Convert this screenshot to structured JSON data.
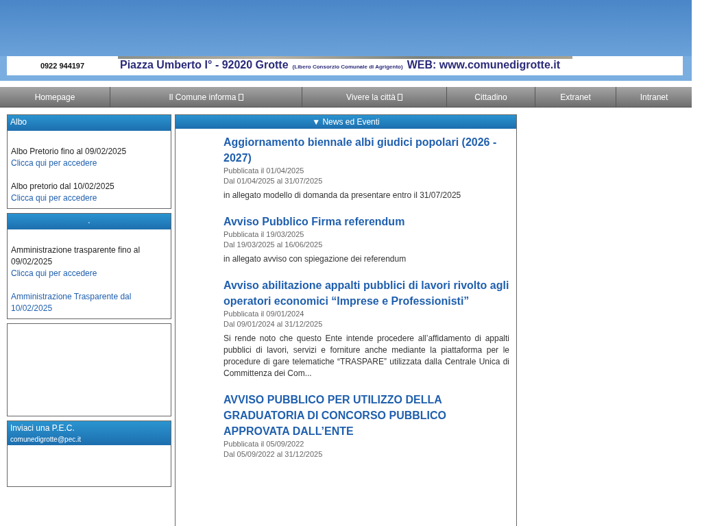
{
  "banner": {
    "phone": "0922 944197",
    "address": "Piazza Umberto I°  - 92020 Grotte",
    "region": "(Libero Consorzio Comunale di Agrigento)",
    "web": "WEB: www.comunedigrotte.it"
  },
  "nav": [
    {
      "label": "Homepage",
      "has_submenu": false
    },
    {
      "label": "Il Comune informa",
      "has_submenu": true
    },
    {
      "label": "Vivere la città",
      "has_submenu": true
    },
    {
      "label": "Cittadino",
      "has_submenu": false
    },
    {
      "label": "Extranet",
      "has_submenu": false
    },
    {
      "label": "Intranet",
      "has_submenu": false
    }
  ],
  "sidebar": [
    {
      "kind": "links",
      "title": "Albo",
      "items": [
        {
          "kind": "text",
          "text": "Albo Pretorio fino al 09/02/2025"
        },
        {
          "kind": "link",
          "text": "Clicca qui per accedere"
        },
        {
          "kind": "gap"
        },
        {
          "kind": "text",
          "text": "Albo pretorio dal 10/02/2025"
        },
        {
          "kind": "link",
          "text": "Clicca qui per accedere"
        }
      ]
    },
    {
      "kind": "links",
      "title": ".",
      "items": [
        {
          "kind": "text",
          "text": "Amministrazione trasparente fino al 09/02/2025"
        },
        {
          "kind": "link",
          "text": "Clicca qui per accedere"
        },
        {
          "kind": "gap"
        },
        {
          "kind": "link",
          "text": "Amministrazione Trasparente dal 10/02/2025"
        }
      ]
    },
    {
      "kind": "empty"
    },
    {
      "kind": "pec",
      "title": "Inviaci una P.E.C.",
      "email": "comunedigrotte@pec.it"
    }
  ],
  "news": {
    "title": "▼ News ed Eventi",
    "items": [
      {
        "title": "Aggiornamento biennale albi giudici popolari (2026 - 2027)",
        "published": "Pubblicata il 01/04/2025",
        "range": "Dal 01/04/2025 al 31/07/2025",
        "summary": "in allegato modello di domanda da presentare entro il 31/07/2025"
      },
      {
        "title": "Avviso Pubblico Firma referendum",
        "published": "Pubblicata il 19/03/2025",
        "range": "Dal 19/03/2025 al 16/06/2025",
        "summary": "in allegato avviso con spiegazione dei referendum"
      },
      {
        "title": "Avviso abilitazione appalti pubblici di lavori rivolto agli operatori economici “Imprese e Professionisti”",
        "published": "Pubblicata il 09/01/2024",
        "range": "Dal 09/01/2024 al 31/12/2025",
        "summary": "Si rende noto che questo Ente intende procedere all’affidamento di appalti pubblici di lavori, servizi e forniture anche mediante la piattaforma per le procedure di gare telematiche “TRASPARE” utilizzata dalla Centrale Unica di Committenza dei Com..."
      },
      {
        "title": "AVVISO PUBBLICO PER UTILIZZO DELLA GRADUATORIA DI CONCORSO PUBBLICO APPROVATA DALL’ENTE",
        "published": "Pubblicata il 05/09/2022",
        "range": "Dal 05/09/2022 al 31/12/2025"
      }
    ]
  }
}
